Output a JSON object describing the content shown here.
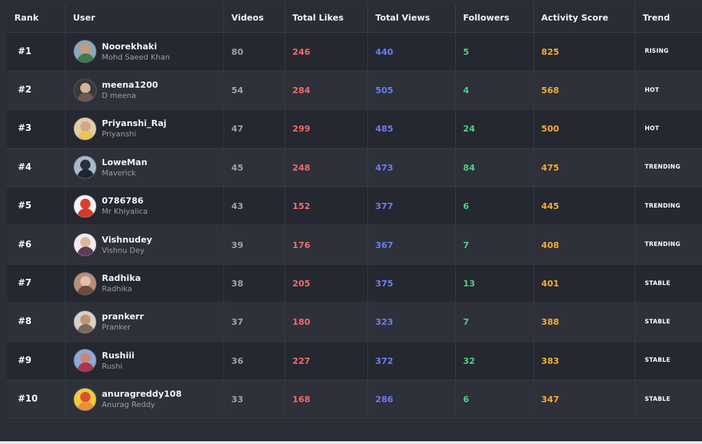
{
  "table": {
    "headers": {
      "rank": "Rank",
      "user": "User",
      "videos": "Videos",
      "likes": "Total Likes",
      "views": "Total Views",
      "followers": "Followers",
      "score": "Activity Score",
      "trend": "Trend"
    },
    "rows": [
      {
        "rank": "#1",
        "username": "Noorekhaki",
        "name": "Mohd Saeed Khan",
        "videos": "80",
        "likes": "246",
        "views": "440",
        "followers": "5",
        "score": "825",
        "trend": "RISING",
        "avatar_bg": "#8ea7b5",
        "avatar_face": "#c79b7a",
        "avatar_body": "#3f7a4a"
      },
      {
        "rank": "#2",
        "username": "meena1200",
        "name": "D meena",
        "videos": "54",
        "likes": "284",
        "views": "505",
        "followers": "4",
        "score": "568",
        "trend": "HOT",
        "avatar_bg": "#3a3a3a",
        "avatar_face": "#d8b39a",
        "avatar_body": "#6b5a4d"
      },
      {
        "rank": "#3",
        "username": "Priyanshi_Raj",
        "name": "Priyanshi",
        "videos": "47",
        "likes": "299",
        "views": "485",
        "followers": "24",
        "score": "500",
        "trend": "HOT",
        "avatar_bg": "#e2cfa7",
        "avatar_face": "#d7a585",
        "avatar_body": "#e8c45a"
      },
      {
        "rank": "#4",
        "username": "LoweMan",
        "name": "Maverick",
        "videos": "45",
        "likes": "248",
        "views": "473",
        "followers": "84",
        "score": "475",
        "trend": "TRENDING",
        "avatar_bg": "#a8b8c8",
        "avatar_face": "#2a2f3a",
        "avatar_body": "#1f2430"
      },
      {
        "rank": "#5",
        "username": "0786786",
        "name": "Mr Khiyalica",
        "videos": "43",
        "likes": "152",
        "views": "377",
        "followers": "6",
        "score": "445",
        "trend": "TRENDING",
        "avatar_bg": "#f3f3f3",
        "avatar_face": "#e03b2c",
        "avatar_body": "#d23a2a"
      },
      {
        "rank": "#6",
        "username": "Vishnudey",
        "name": "Vishnu Dey",
        "videos": "39",
        "likes": "176",
        "views": "367",
        "followers": "7",
        "score": "408",
        "trend": "TRENDING",
        "avatar_bg": "#f0ecef",
        "avatar_face": "#e2b49b",
        "avatar_body": "#5b3c55"
      },
      {
        "rank": "#7",
        "username": "Radhika",
        "name": "Radhika",
        "videos": "38",
        "likes": "205",
        "views": "375",
        "followers": "13",
        "score": "401",
        "trend": "STABLE",
        "avatar_bg": "#b58f7a",
        "avatar_face": "#e2c0a6",
        "avatar_body": "#6e4b3c"
      },
      {
        "rank": "#8",
        "username": "prankerr",
        "name": "Pranker",
        "videos": "37",
        "likes": "180",
        "views": "323",
        "followers": "7",
        "score": "388",
        "trend": "STABLE",
        "avatar_bg": "#d6d0c8",
        "avatar_face": "#c09372",
        "avatar_body": "#7d6a5a"
      },
      {
        "rank": "#9",
        "username": "Rushiii",
        "name": "Rushi",
        "videos": "36",
        "likes": "227",
        "views": "372",
        "followers": "32",
        "score": "383",
        "trend": "STABLE",
        "avatar_bg": "#8fa8d6",
        "avatar_face": "#c9877a",
        "avatar_body": "#b2334a"
      },
      {
        "rank": "#10",
        "username": "anuragreddy108",
        "name": "Anurag Reddy",
        "videos": "33",
        "likes": "168",
        "views": "286",
        "followers": "6",
        "score": "347",
        "trend": "STABLE",
        "avatar_bg": "#f0c93c",
        "avatar_face": "#d94f2f",
        "avatar_body": "#e8913a"
      }
    ]
  }
}
